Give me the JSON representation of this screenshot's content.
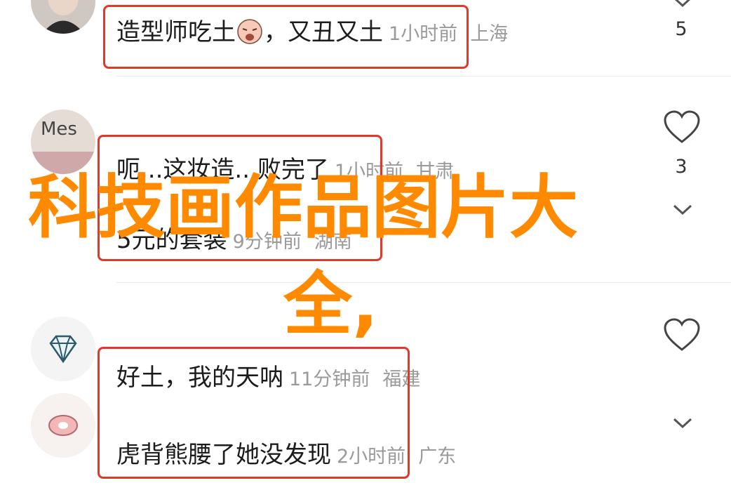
{
  "comments": [
    {
      "text": "造型师吃土",
      "emoji": "tired-face-emoji",
      "reply": "，又丑又土",
      "time": "1小时前",
      "location": "上海",
      "likes": "5"
    },
    {
      "avatar_text": "Mes",
      "text": "呃...这妆造...败完了",
      "time": "1小时前",
      "location": "甘肃",
      "likes": "3"
    },
    {
      "text": "5元的套装",
      "time": "9分钟前",
      "location": "湖南"
    },
    {
      "text": "好土，我的天呐",
      "time": "11分钟前",
      "location": "福建"
    },
    {
      "text": "虎背熊腰了她没发现",
      "time": "2小时前",
      "location": "广东"
    }
  ],
  "overlay": {
    "line1": "科技画作品图片大",
    "line2": "全,"
  },
  "colors": {
    "overlay": "#ff8a00",
    "highlight_box": "#e0392b",
    "meta_text": "#9a9a9a"
  }
}
